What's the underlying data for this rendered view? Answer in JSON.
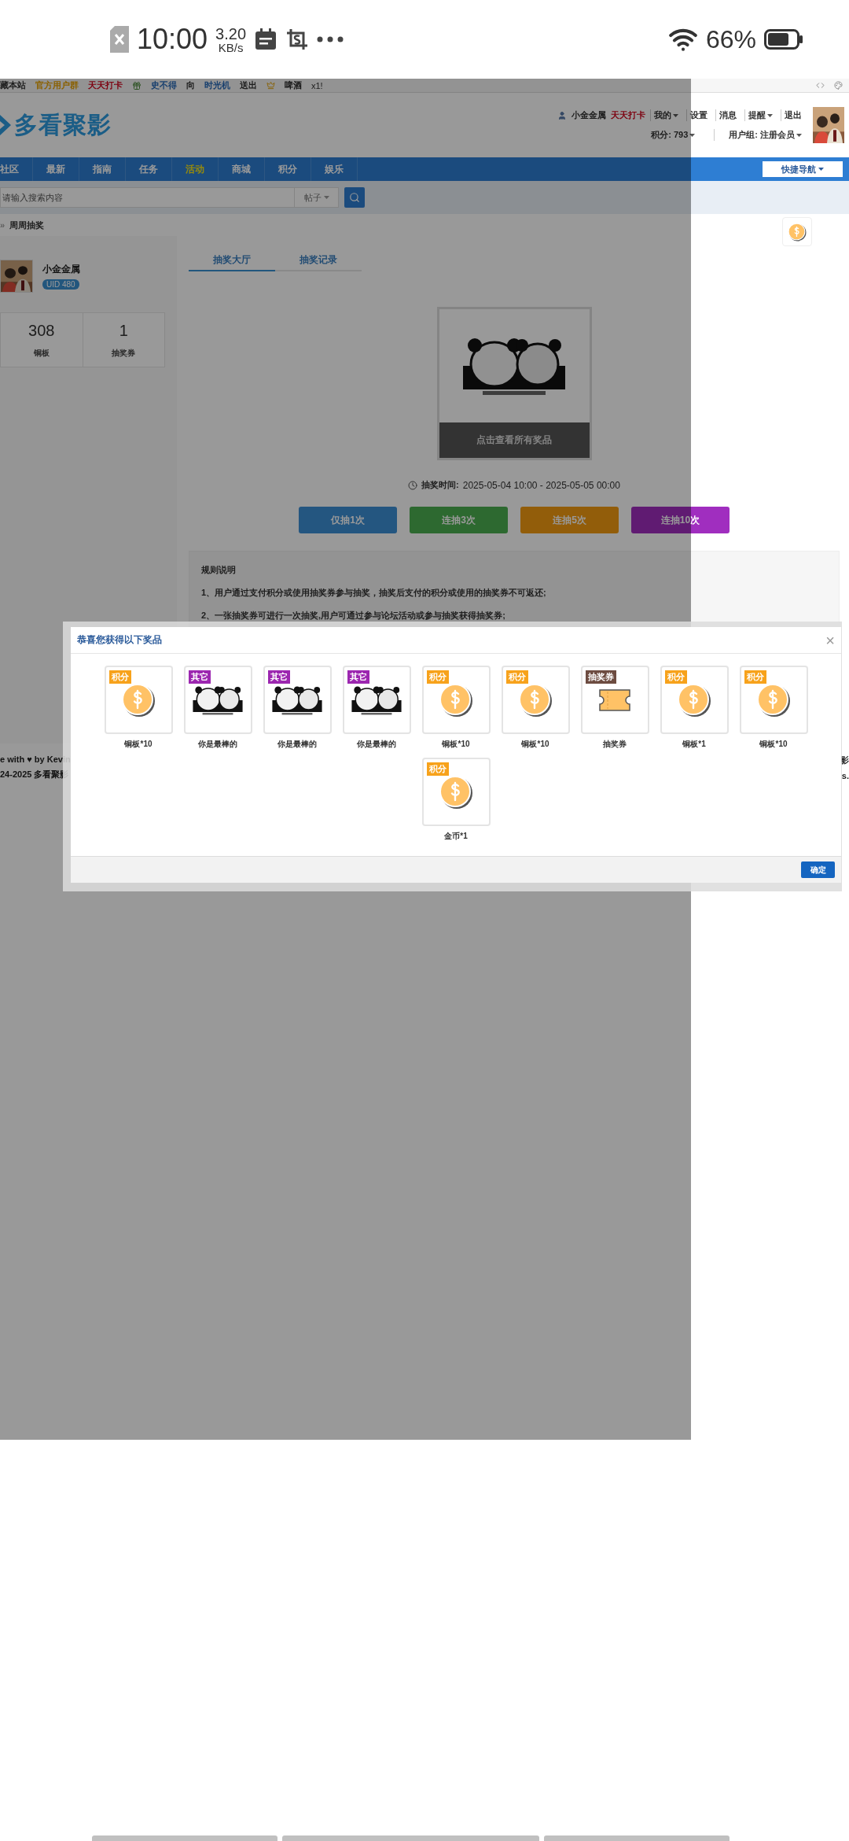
{
  "status_bar": {
    "time": "10:00",
    "speed": "3.20",
    "speed_unit": "KB/s",
    "battery": "66%"
  },
  "top_bar": {
    "links": [
      {
        "text": "藏本站",
        "kind": "plain"
      },
      {
        "text": "官方用户群",
        "kind": "group"
      },
      {
        "text": "天天打卡",
        "kind": "alert"
      }
    ],
    "message": [
      {
        "text": "史不得",
        "kind": "link"
      },
      {
        "text": "向",
        "kind": "plain"
      },
      {
        "text": "时光机",
        "kind": "link"
      },
      {
        "text": "送出",
        "kind": "plain"
      }
    ],
    "gift": "啤酒",
    "count": "x1!"
  },
  "header": {
    "logo": "多看聚影",
    "user": "小金金属",
    "checkin": "天天打卡",
    "menu": [
      {
        "label": "我的",
        "dropdown": true
      },
      {
        "label": "设置",
        "dropdown": false
      },
      {
        "label": "消息",
        "dropdown": false
      },
      {
        "label": "提醒",
        "dropdown": true
      },
      {
        "label": "退出",
        "dropdown": false
      }
    ],
    "info": [
      {
        "label": "积分: 793",
        "dropdown": true
      },
      {
        "label": "用户组: 注册会员",
        "dropdown": true
      }
    ]
  },
  "nav": {
    "items": [
      {
        "label": "社区",
        "kind": "plain"
      },
      {
        "label": "最新",
        "kind": "plain"
      },
      {
        "label": "指南",
        "kind": "plain"
      },
      {
        "label": "任务",
        "kind": "plain"
      },
      {
        "label": "活动",
        "kind": "highlight"
      },
      {
        "label": "商城",
        "kind": "plain"
      },
      {
        "label": "积分",
        "kind": "plain"
      },
      {
        "label": "娱乐",
        "kind": "plain"
      }
    ],
    "quick_nav": "快捷导航"
  },
  "search": {
    "placeholder": "请输入搜索内容",
    "scope": "帖子"
  },
  "breadcrumb": {
    "separator": "»",
    "current": "周周抽奖"
  },
  "profile": {
    "name": "小金金属",
    "uid": "UID 480",
    "stats": [
      {
        "value": "308",
        "label": "铜板"
      },
      {
        "value": "1",
        "label": "抽奖券"
      }
    ]
  },
  "tabs": [
    {
      "label": "抽奖大厅",
      "selected": true
    },
    {
      "label": "抽奖记录",
      "selected": false
    }
  ],
  "prize_box": {
    "kind": "picture",
    "link": "点击查看所有奖品"
  },
  "draw_time": {
    "label": "抽奖时间:",
    "value": "2025-05-04 10:00 - 2025-05-05 00:00"
  },
  "draw_buttons": [
    {
      "label": "仅抽1次",
      "kind": "blue"
    },
    {
      "label": "连抽3次",
      "kind": "green"
    },
    {
      "label": "连抽5次",
      "kind": "orange"
    },
    {
      "label": "连抽10次",
      "kind": "purple"
    }
  ],
  "rules": {
    "title": "规则说明",
    "lines": [
      "1、用户通过支付积分或使用抽奖券参与抽奖，抽奖后支付的积分或使用的抽奖券不可返还;",
      "2、一张抽奖券可进行一次抽奖,用户可通过参与论坛活动或参与抽奖获得抽奖券;"
    ]
  },
  "footer": {
    "left": [
      "e with ♥ by Kevin",
      "24-2025 多看聚影"
    ],
    "right": [
      "影",
      "s."
    ]
  },
  "modal": {
    "title": "恭喜您获得以下奖品",
    "close": "×",
    "confirm": "确定",
    "prizes": [
      {
        "tag": "积分",
        "color": "#f7a21b",
        "kind": "coin",
        "name": "铜板*10"
      },
      {
        "tag": "其它",
        "color": "#9c27b0",
        "kind": "picture",
        "name": "你是最棒的"
      },
      {
        "tag": "其它",
        "color": "#9c27b0",
        "kind": "picture",
        "name": "你是最棒的"
      },
      {
        "tag": "其它",
        "color": "#9c27b0",
        "kind": "picture",
        "name": "你是最棒的"
      },
      {
        "tag": "积分",
        "color": "#f7a21b",
        "kind": "coin",
        "name": "铜板*10"
      },
      {
        "tag": "积分",
        "color": "#f7a21b",
        "kind": "coin",
        "name": "铜板*10"
      },
      {
        "tag": "抽奖券",
        "color": "#6d4c41",
        "kind": "ticket",
        "name": "抽奖券"
      },
      {
        "tag": "积分",
        "color": "#f7a21b",
        "kind": "coin",
        "name": "铜板*1"
      },
      {
        "tag": "积分",
        "color": "#f7a21b",
        "kind": "coin",
        "name": "铜板*10"
      },
      {
        "tag": "积分",
        "color": "#f7a21b",
        "kind": "coin",
        "name": "金币*1"
      }
    ]
  }
}
